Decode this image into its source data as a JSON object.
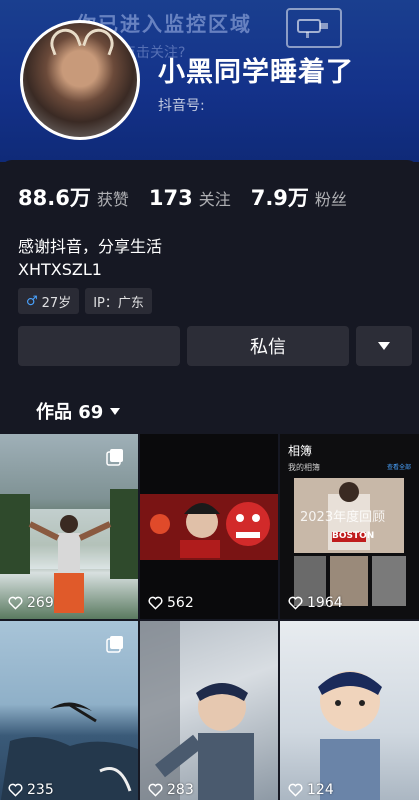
{
  "banner": {
    "text": "你已进入监控区域",
    "sub": "没点击关注?"
  },
  "profile": {
    "nickname": "小黑同学睡着了",
    "douyin_id_label": "抖音号:"
  },
  "stats": [
    {
      "value": "88.6万",
      "label": "获赞"
    },
    {
      "value": "173",
      "label": "关注"
    },
    {
      "value": "7.9万",
      "label": "粉丝"
    }
  ],
  "bio": {
    "line1": "感谢抖音，分享生活",
    "line2": "XHTXSZL1"
  },
  "tags": {
    "gender_symbol": "♂",
    "age": "27岁",
    "ip": "IP：广东"
  },
  "buttons": {
    "message": "私信",
    "dropdown_icon": "triangle-down-icon"
  },
  "works_tab": {
    "label": "作品 69"
  },
  "album": {
    "title": "相簿",
    "sub": "我的相簿",
    "more": "查看全部",
    "overlay": "2023年度回顾",
    "shirt": "BOSTON"
  },
  "videos": [
    {
      "likes": "269"
    },
    {
      "likes": "562"
    },
    {
      "likes": "1964"
    },
    {
      "likes": "235"
    },
    {
      "likes": "283"
    },
    {
      "likes": "124"
    }
  ],
  "colors": {
    "background": "#161823",
    "banner": "#1a3f8f",
    "gender": "#4aa3ff"
  }
}
